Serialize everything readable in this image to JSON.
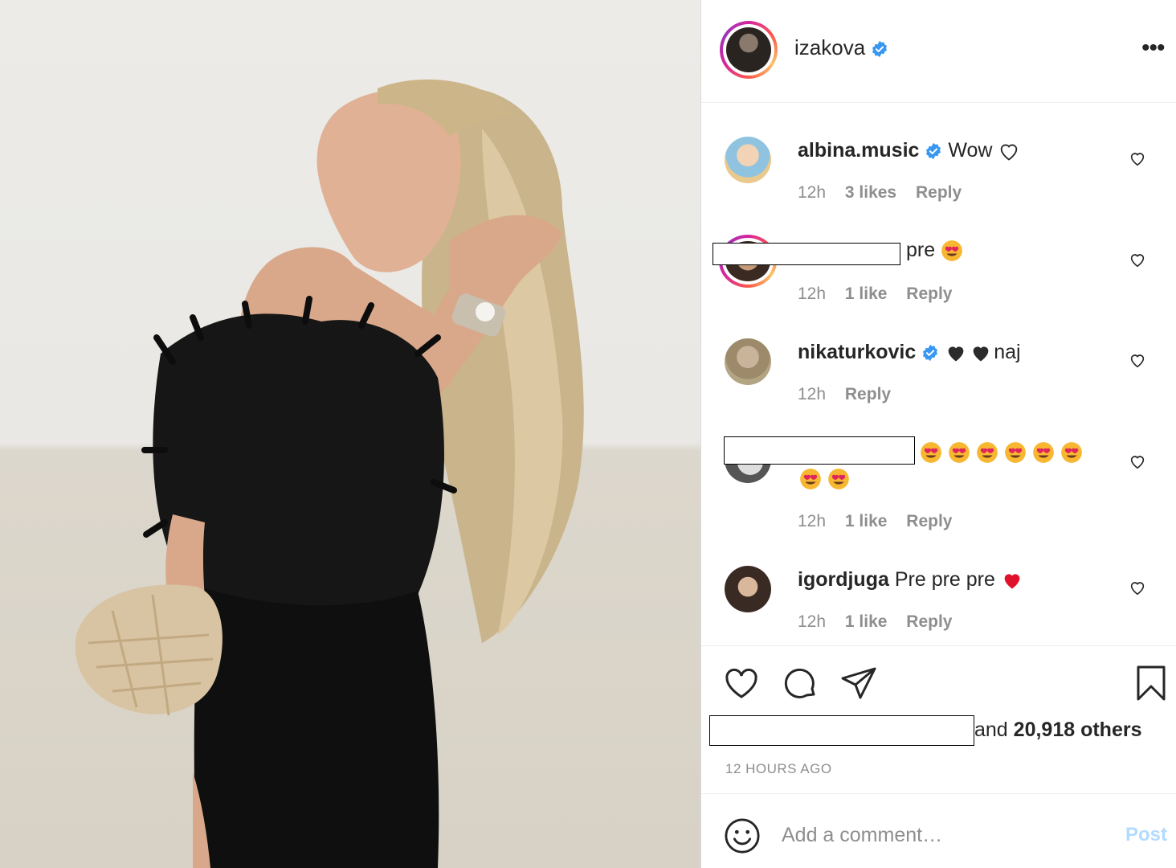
{
  "post": {
    "owner": "izakova",
    "more_label": "•••"
  },
  "comments": [
    {
      "user": "albina.music",
      "text": "Wow ",
      "time": "12h",
      "likes": "3 likes",
      "reply": "Reply"
    },
    {
      "user": "",
      "text": "pre ",
      "time": "12h",
      "likes": "1 like",
      "reply": "Reply"
    },
    {
      "user": "nikaturkovic",
      "text": "naj",
      "time": "12h",
      "likes": "",
      "reply": "Reply"
    },
    {
      "user": "",
      "text": "",
      "time": "12h",
      "likes": "1 like",
      "reply": "Reply"
    },
    {
      "user": "igordjuga",
      "text": "Pre pre pre ",
      "time": "12h",
      "likes": "1 like",
      "reply": "Reply"
    }
  ],
  "likes": {
    "prefix": "and ",
    "count": "20,918 others"
  },
  "time_ago": "12 HOURS AGO",
  "add_comment": {
    "placeholder": "Add a comment…",
    "post_label": "Post"
  },
  "colors": {
    "verified": "#3897f0",
    "post_disabled": "#b3dbff",
    "meta_grey": "#8e8e8e"
  },
  "icons": [
    "heart-icon",
    "comment-icon",
    "share-icon",
    "bookmark-icon",
    "smile-icon",
    "verified-icon"
  ]
}
